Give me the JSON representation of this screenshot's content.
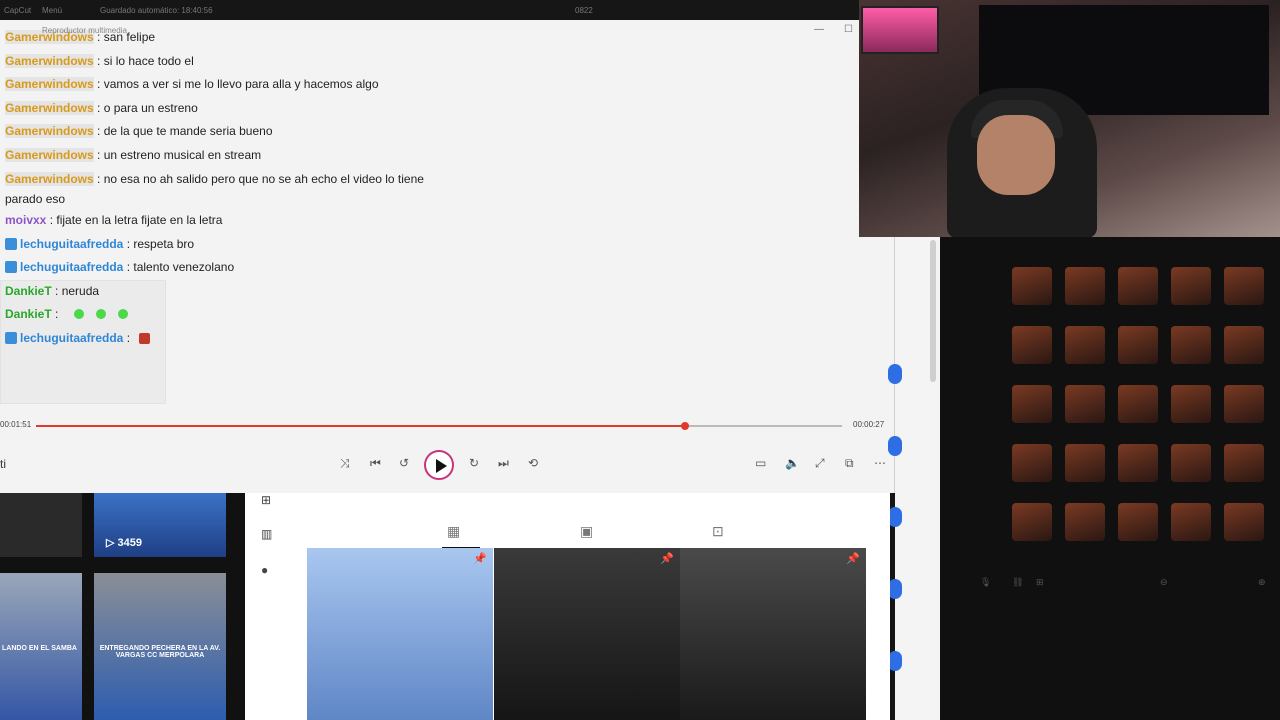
{
  "topbar": {
    "app": "CapCut",
    "menu": "Menú",
    "autosave": "Guardado automático: 18:40:56",
    "project": "0822"
  },
  "player": {
    "title": "Reproductor multimedia",
    "time_elapsed": "00:01:51",
    "time_remaining": "00:00:27",
    "progress": 0.805,
    "left_text": "ti"
  },
  "chat": [
    {
      "user": "Gamerwindows",
      "text": "san felipe",
      "type": "gamer"
    },
    {
      "user": "Gamerwindows",
      "text": "si lo hace todo el",
      "type": "gamer"
    },
    {
      "user": "Gamerwindows",
      "text": "vamos a ver si me lo llevo para alla y hacemos algo",
      "type": "gamer"
    },
    {
      "user": "Gamerwindows",
      "text": "o para un estreno",
      "type": "gamer"
    },
    {
      "user": "Gamerwindows",
      "text": "de la que te mande seria bueno",
      "type": "gamer"
    },
    {
      "user": "Gamerwindows",
      "text": "un estreno musical en stream",
      "type": "gamer"
    },
    {
      "user": "Gamerwindows",
      "text": "no esa no ah salido pero que no se ah echo el video lo tiene parado eso",
      "type": "gamer"
    },
    {
      "user": "moivxx",
      "text": "fijate en la letra fijate en la letra",
      "type": "moi"
    },
    {
      "user": "lechuguitaafredda",
      "text": "respeta bro",
      "type": "lech"
    },
    {
      "user": "lechuguitaafredda",
      "text": "talento venezolano",
      "type": "lech"
    },
    {
      "user": "DankieT",
      "text": "neruda",
      "type": "dank"
    },
    {
      "user": "DankieT",
      "text": "",
      "type": "dank"
    },
    {
      "user": "lechuguitaafredda",
      "text": "",
      "type": "lech"
    }
  ],
  "bottom": {
    "view_count": "3459",
    "caption_1": "LANDO EN EL SAMBA",
    "caption_2": "ENTREGANDO PECHERA EN LA AV. VARGAS CC MERPOLARA"
  },
  "colors": {
    "accent": "#e23a2a",
    "play_ring": "#c9327d",
    "gamer": "#d89a1a",
    "lech": "#2f86d6",
    "dank": "#2aa82a",
    "moi": "#8d54c7"
  }
}
